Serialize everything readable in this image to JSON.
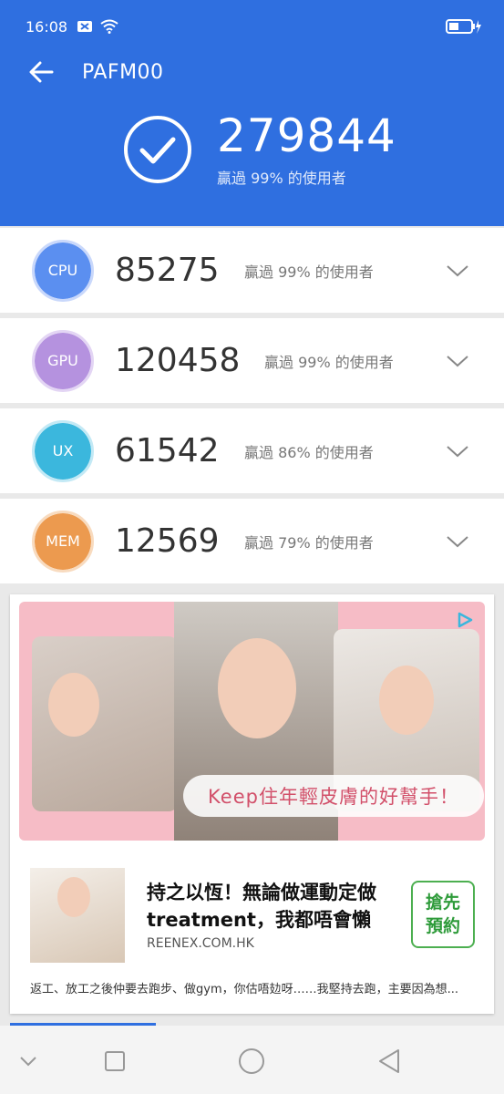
{
  "status_bar": {
    "time": "16:08",
    "icons": [
      "notification-icon",
      "wifi-icon",
      "battery-charging-icon"
    ]
  },
  "header": {
    "title": "PAFM00",
    "total_score": "279844",
    "total_subtitle": "贏過 99% 的使用者"
  },
  "scores": [
    {
      "id": "cpu",
      "label": "CPU",
      "value": "85275",
      "percent_text": "贏過 99% 的使用者",
      "color": "#5b8ff0",
      "ring": "#c9d8fb"
    },
    {
      "id": "gpu",
      "label": "GPU",
      "value": "120458",
      "percent_text": "贏過 99% 的使用者",
      "color": "#b592df",
      "ring": "#e3d5f4"
    },
    {
      "id": "ux",
      "label": "UX",
      "value": "61542",
      "percent_text": "贏過 86% 的使用者",
      "color": "#3bb7dd",
      "ring": "#c3e9f5"
    },
    {
      "id": "mem",
      "label": "MEM",
      "value": "12569",
      "percent_text": "贏過 79% 的使用者",
      "color": "#ec9a4f",
      "ring": "#f8dbbf"
    }
  ],
  "ad": {
    "banner_tagline": "Keep住年輕皮膚的好幫手！",
    "headline": "持之以恆！無論做運動定做treatment，我都唔會懶",
    "domain": "REENEX.COM.HK",
    "cta": "搶先預約",
    "body": "返工、放工之後仲要去跑步、做gym，你估唔攰呀……我堅持去跑，主要因為想..."
  },
  "colors": {
    "brand": "#2f6fe0",
    "cta_green": "#2e9b3a"
  }
}
